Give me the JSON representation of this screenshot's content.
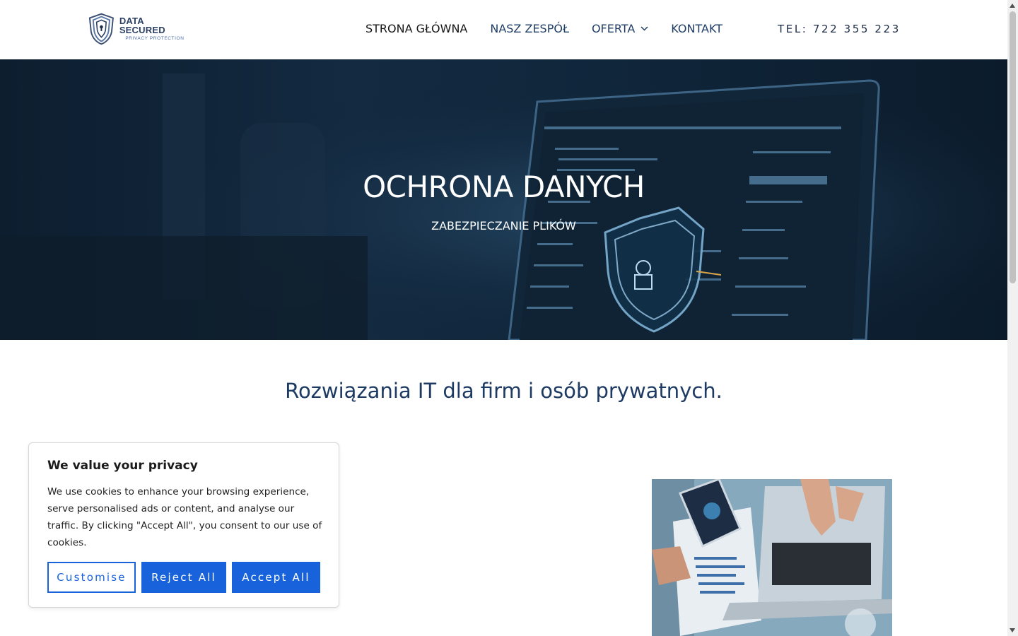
{
  "header": {
    "logo": {
      "title": "DATA SECURED",
      "subtitle": "PRIVACY PROTECTION"
    },
    "nav": [
      {
        "label": "STRONA GŁÓWNA",
        "active": true
      },
      {
        "label": "NASZ ZESPÓŁ"
      },
      {
        "label": "OFERTA",
        "has_dropdown": true
      },
      {
        "label": "KONTAKT"
      }
    ],
    "phone": "TEL: 722 355 223"
  },
  "hero": {
    "title": "OCHRONA DANYCH",
    "subtitle": "ZABEZPIECZANIE PLIKÓW"
  },
  "main": {
    "section_title": "Rozwiązania IT dla firm i osób prywatnych."
  },
  "cookie_banner": {
    "title": "We value your privacy",
    "text": "We use cookies to enhance your browsing experience, serve personalised ads or content, and analyse our traffic. By clicking \"Accept All\", you consent to our use of cookies.",
    "buttons": {
      "customise": "Customise",
      "reject": "Reject All",
      "accept": "Accept All"
    }
  },
  "colors": {
    "nav_link": "#1f3d66",
    "nav_active": "#161616",
    "heading": "#1d3a63",
    "button": "#1863dc",
    "hero_bg": "#132a41"
  },
  "icons": [
    "shield-lock-logo-icon",
    "chevron-down-icon",
    "scroll-up-arrow-icon",
    "scroll-down-arrow-icon"
  ]
}
